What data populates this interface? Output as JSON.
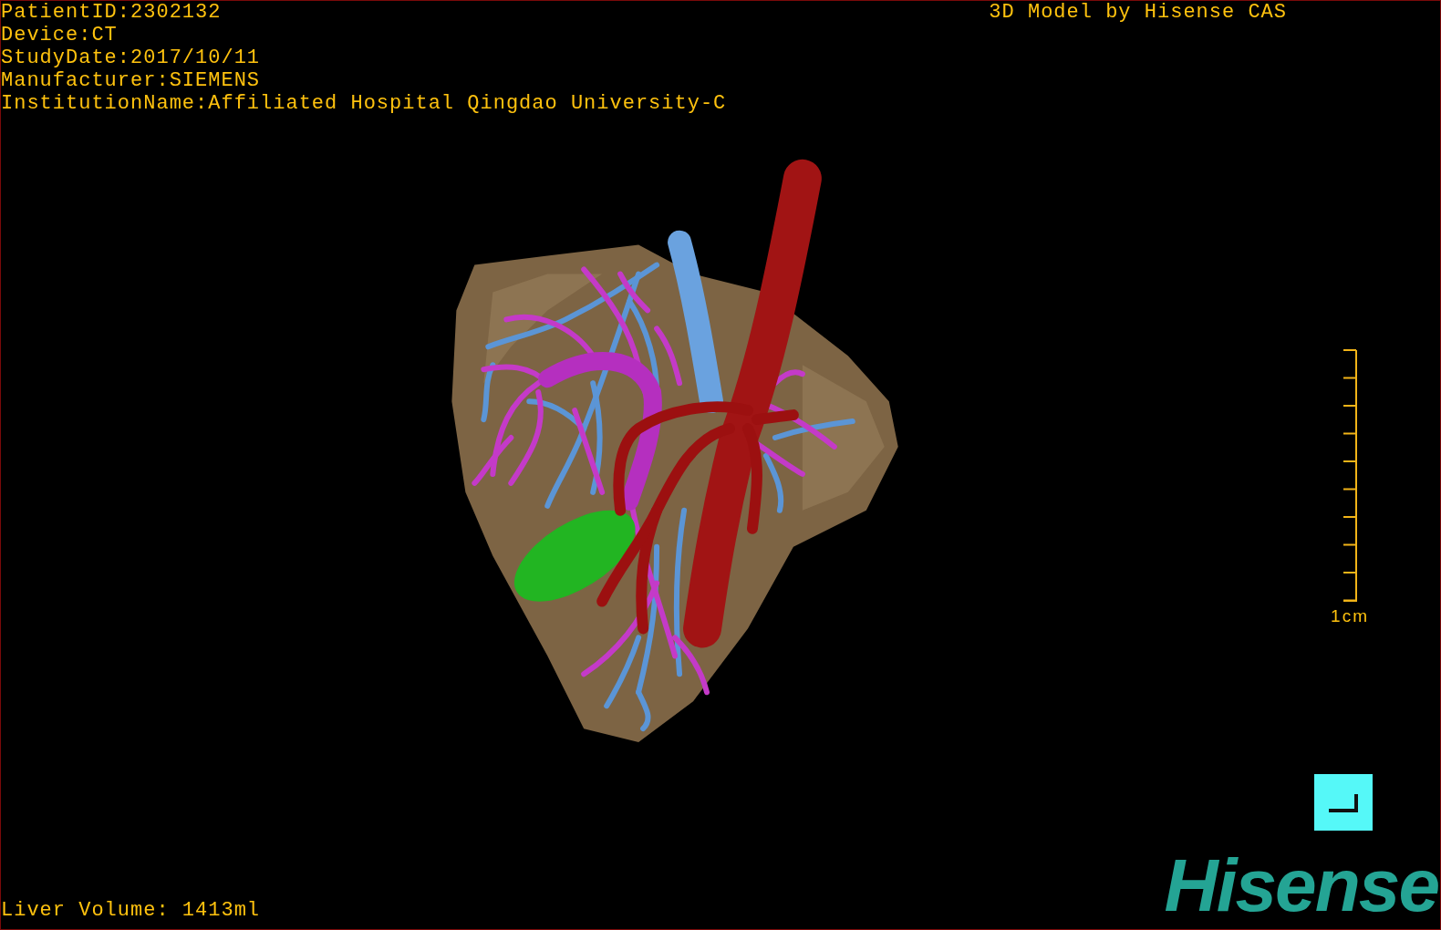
{
  "study_info": [
    "PatientID:2302132",
    "Device:CT",
    "StudyDate:2017/10/11",
    "Manufacturer:SIEMENS",
    "InstitutionName:Affiliated Hospital Qingdao University-C"
  ],
  "title": "3D Model by Hisense CAS",
  "scale_bar": {
    "label": "1cm"
  },
  "liver_volume": "Liver Volume: 1413ml",
  "logo": "Hisense"
}
